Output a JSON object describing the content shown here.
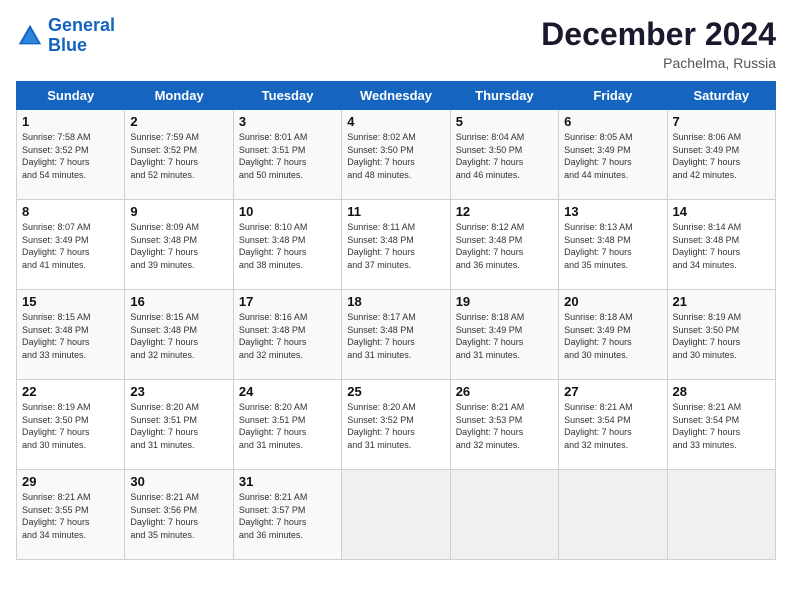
{
  "header": {
    "logo_line1": "General",
    "logo_line2": "Blue",
    "month_title": "December 2024",
    "location": "Pachelma, Russia"
  },
  "days_of_week": [
    "Sunday",
    "Monday",
    "Tuesday",
    "Wednesday",
    "Thursday",
    "Friday",
    "Saturday"
  ],
  "weeks": [
    [
      {
        "day": "1",
        "info": "Sunrise: 7:58 AM\nSunset: 3:52 PM\nDaylight: 7 hours\nand 54 minutes."
      },
      {
        "day": "2",
        "info": "Sunrise: 7:59 AM\nSunset: 3:52 PM\nDaylight: 7 hours\nand 52 minutes."
      },
      {
        "day": "3",
        "info": "Sunrise: 8:01 AM\nSunset: 3:51 PM\nDaylight: 7 hours\nand 50 minutes."
      },
      {
        "day": "4",
        "info": "Sunrise: 8:02 AM\nSunset: 3:50 PM\nDaylight: 7 hours\nand 48 minutes."
      },
      {
        "day": "5",
        "info": "Sunrise: 8:04 AM\nSunset: 3:50 PM\nDaylight: 7 hours\nand 46 minutes."
      },
      {
        "day": "6",
        "info": "Sunrise: 8:05 AM\nSunset: 3:49 PM\nDaylight: 7 hours\nand 44 minutes."
      },
      {
        "day": "7",
        "info": "Sunrise: 8:06 AM\nSunset: 3:49 PM\nDaylight: 7 hours\nand 42 minutes."
      }
    ],
    [
      {
        "day": "8",
        "info": "Sunrise: 8:07 AM\nSunset: 3:49 PM\nDaylight: 7 hours\nand 41 minutes."
      },
      {
        "day": "9",
        "info": "Sunrise: 8:09 AM\nSunset: 3:48 PM\nDaylight: 7 hours\nand 39 minutes."
      },
      {
        "day": "10",
        "info": "Sunrise: 8:10 AM\nSunset: 3:48 PM\nDaylight: 7 hours\nand 38 minutes."
      },
      {
        "day": "11",
        "info": "Sunrise: 8:11 AM\nSunset: 3:48 PM\nDaylight: 7 hours\nand 37 minutes."
      },
      {
        "day": "12",
        "info": "Sunrise: 8:12 AM\nSunset: 3:48 PM\nDaylight: 7 hours\nand 36 minutes."
      },
      {
        "day": "13",
        "info": "Sunrise: 8:13 AM\nSunset: 3:48 PM\nDaylight: 7 hours\nand 35 minutes."
      },
      {
        "day": "14",
        "info": "Sunrise: 8:14 AM\nSunset: 3:48 PM\nDaylight: 7 hours\nand 34 minutes."
      }
    ],
    [
      {
        "day": "15",
        "info": "Sunrise: 8:15 AM\nSunset: 3:48 PM\nDaylight: 7 hours\nand 33 minutes."
      },
      {
        "day": "16",
        "info": "Sunrise: 8:15 AM\nSunset: 3:48 PM\nDaylight: 7 hours\nand 32 minutes."
      },
      {
        "day": "17",
        "info": "Sunrise: 8:16 AM\nSunset: 3:48 PM\nDaylight: 7 hours\nand 32 minutes."
      },
      {
        "day": "18",
        "info": "Sunrise: 8:17 AM\nSunset: 3:48 PM\nDaylight: 7 hours\nand 31 minutes."
      },
      {
        "day": "19",
        "info": "Sunrise: 8:18 AM\nSunset: 3:49 PM\nDaylight: 7 hours\nand 31 minutes."
      },
      {
        "day": "20",
        "info": "Sunrise: 8:18 AM\nSunset: 3:49 PM\nDaylight: 7 hours\nand 30 minutes."
      },
      {
        "day": "21",
        "info": "Sunrise: 8:19 AM\nSunset: 3:50 PM\nDaylight: 7 hours\nand 30 minutes."
      }
    ],
    [
      {
        "day": "22",
        "info": "Sunrise: 8:19 AM\nSunset: 3:50 PM\nDaylight: 7 hours\nand 30 minutes."
      },
      {
        "day": "23",
        "info": "Sunrise: 8:20 AM\nSunset: 3:51 PM\nDaylight: 7 hours\nand 31 minutes."
      },
      {
        "day": "24",
        "info": "Sunrise: 8:20 AM\nSunset: 3:51 PM\nDaylight: 7 hours\nand 31 minutes."
      },
      {
        "day": "25",
        "info": "Sunrise: 8:20 AM\nSunset: 3:52 PM\nDaylight: 7 hours\nand 31 minutes."
      },
      {
        "day": "26",
        "info": "Sunrise: 8:21 AM\nSunset: 3:53 PM\nDaylight: 7 hours\nand 32 minutes."
      },
      {
        "day": "27",
        "info": "Sunrise: 8:21 AM\nSunset: 3:54 PM\nDaylight: 7 hours\nand 32 minutes."
      },
      {
        "day": "28",
        "info": "Sunrise: 8:21 AM\nSunset: 3:54 PM\nDaylight: 7 hours\nand 33 minutes."
      }
    ],
    [
      {
        "day": "29",
        "info": "Sunrise: 8:21 AM\nSunset: 3:55 PM\nDaylight: 7 hours\nand 34 minutes."
      },
      {
        "day": "30",
        "info": "Sunrise: 8:21 AM\nSunset: 3:56 PM\nDaylight: 7 hours\nand 35 minutes."
      },
      {
        "day": "31",
        "info": "Sunrise: 8:21 AM\nSunset: 3:57 PM\nDaylight: 7 hours\nand 36 minutes."
      },
      {
        "day": "",
        "info": ""
      },
      {
        "day": "",
        "info": ""
      },
      {
        "day": "",
        "info": ""
      },
      {
        "day": "",
        "info": ""
      }
    ]
  ]
}
